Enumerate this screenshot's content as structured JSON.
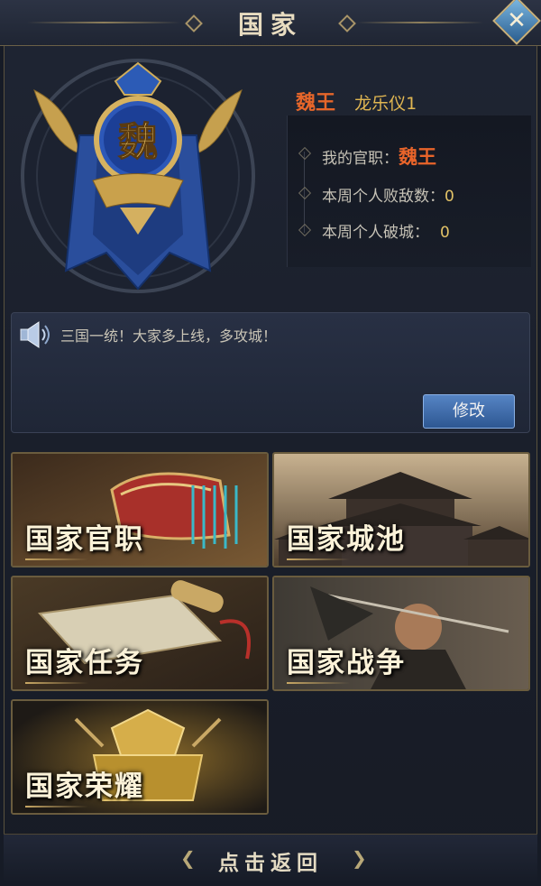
{
  "header": {
    "title": "国家",
    "close_icon": "close-icon"
  },
  "emblem": {
    "char": "魏"
  },
  "king": {
    "title": "魏王",
    "player_name": "龙乐仪1"
  },
  "info": {
    "official_label": "我的官职：",
    "official_value": "魏王",
    "kills_label": "本周个人败敌数：",
    "kills_value": "0",
    "cities_label": "本周个人破城：",
    "cities_value": "0"
  },
  "announcement": {
    "text": "三国一统！大家多上线，多攻城！",
    "edit_label": "修改",
    "icon": "speaker-icon"
  },
  "cards": [
    {
      "label": "国家官职"
    },
    {
      "label": "国家城池"
    },
    {
      "label": "国家任务"
    },
    {
      "label": "国家战争"
    },
    {
      "label": "国家荣耀"
    }
  ],
  "footer": {
    "back_label": "点击返回"
  },
  "colors": {
    "accent_gold": "#c9a865",
    "king_orange": "#e6662a",
    "button_blue": "#3a68a8"
  }
}
